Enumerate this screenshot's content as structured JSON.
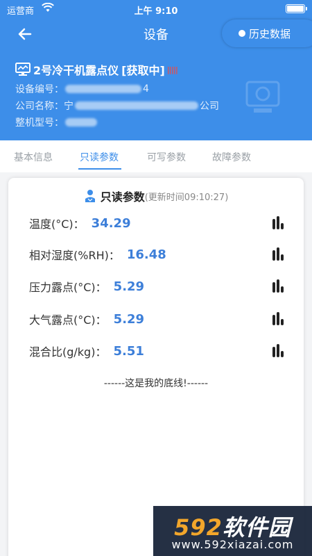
{
  "status_bar": {
    "carrier": "运营商",
    "time": "上午 9:10"
  },
  "header": {
    "title": "设备",
    "history_label": "历史数据",
    "device_name": "2号冷干机露点仪",
    "device_status": "[获取中]",
    "info": [
      {
        "label": "设备编号：",
        "value_suffix": "4"
      },
      {
        "label": "公司名称：",
        "value_prefix": "宁",
        "value_suffix": "公司"
      },
      {
        "label": "整机型号："
      }
    ]
  },
  "tabs": [
    {
      "label": "基本信息",
      "active": false
    },
    {
      "label": "只读参数",
      "active": true
    },
    {
      "label": "可写参数",
      "active": false
    },
    {
      "label": "故障参数",
      "active": false
    }
  ],
  "card": {
    "title": "只读参数",
    "update_text": "(更新时间09:10:27)",
    "params": [
      {
        "label": "温度(°C)：",
        "value": "34.29"
      },
      {
        "label": "相对湿度(%RH)：",
        "value": "16.48"
      },
      {
        "label": "压力露点(°C)：",
        "value": "5.29"
      },
      {
        "label": "大气露点(°C)：",
        "value": "5.29"
      },
      {
        "label": "混合比(g/kg)：",
        "value": "5.51"
      }
    ],
    "bottom_text": "------这是我的底线!------"
  },
  "watermark": {
    "num": "592",
    "text": "软件园",
    "url": "www.592xiazai.com"
  },
  "colors": {
    "primary": "#3d8ee9",
    "value_blue": "#3d7fd9",
    "signal_red": "#e84c4c",
    "watermark_orange": "#f2a62b"
  },
  "icons": [
    "wifi-icon",
    "battery-icon",
    "back-arrow-icon",
    "monitor-icon",
    "signal-icon",
    "user-icon",
    "bar-chart-icon"
  ]
}
